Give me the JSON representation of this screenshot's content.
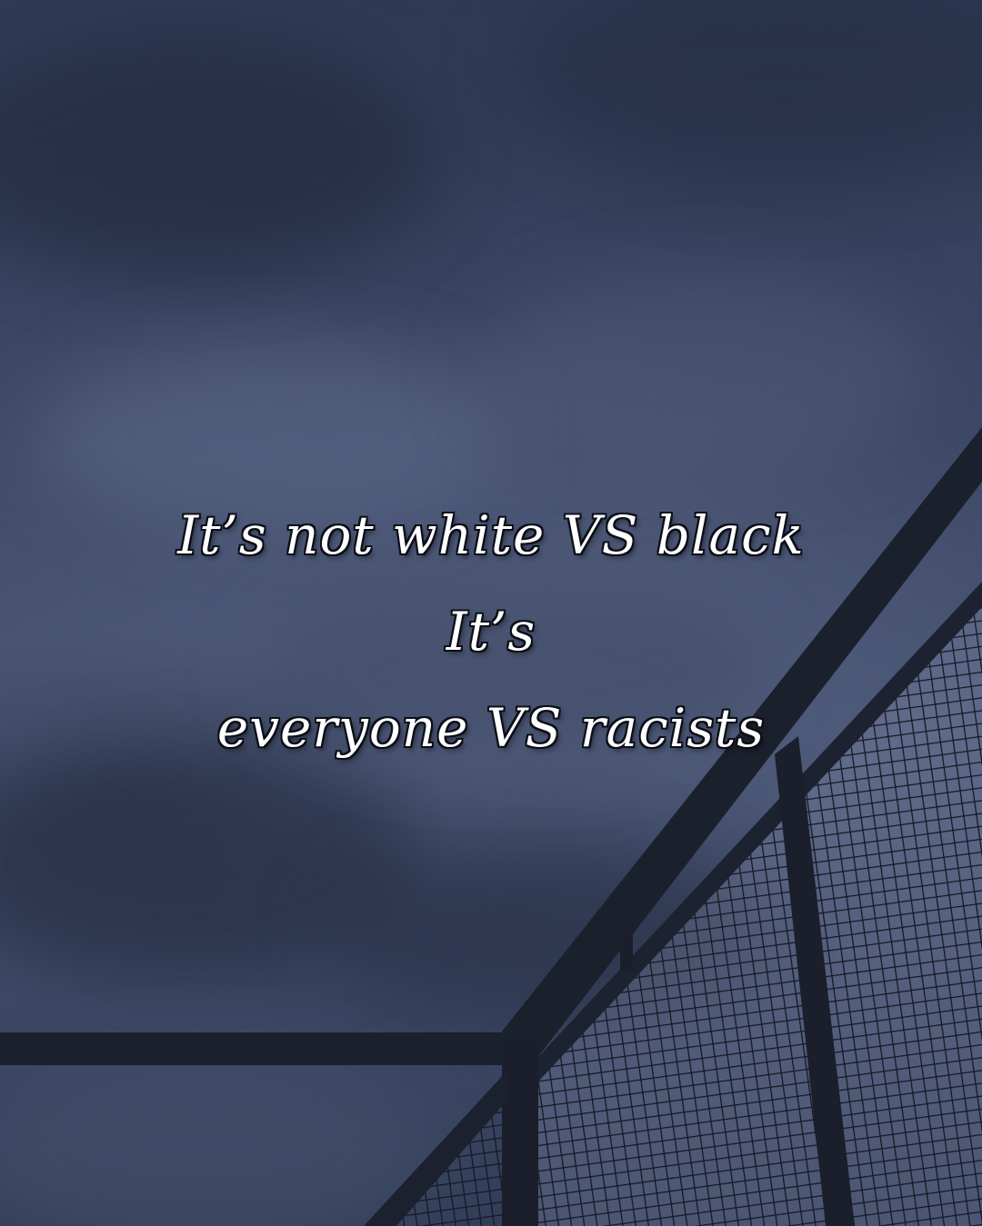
{
  "quote": {
    "line1": "It’s not white VS black",
    "line2": "It’s",
    "line3": "everyone VS racists"
  },
  "colors": {
    "sky": "#3d4866",
    "railing": "#1a1f2c",
    "text": "#ffffff",
    "text_outline": "#0c0f18"
  }
}
